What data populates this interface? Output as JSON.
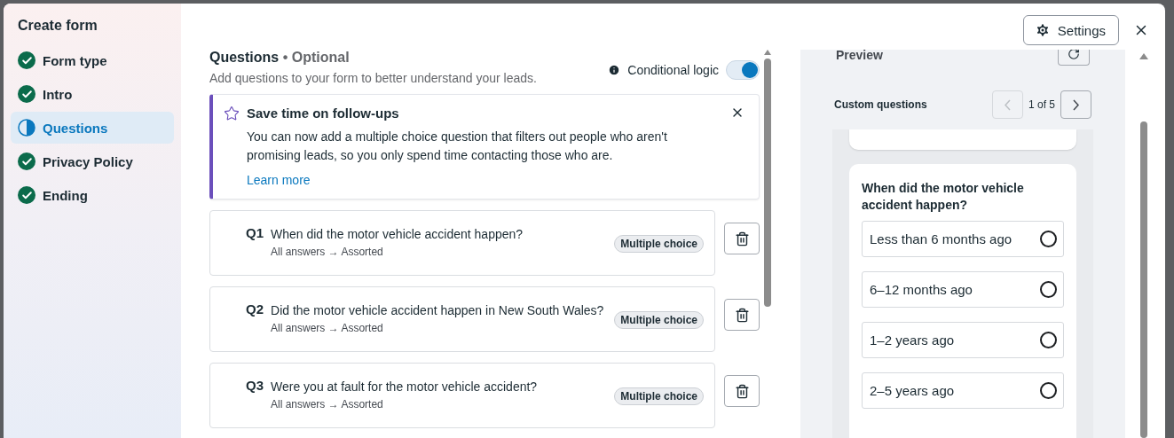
{
  "sidebar": {
    "title": "Create form",
    "steps": [
      {
        "label": "Form type",
        "complete": true,
        "selected": false
      },
      {
        "label": "Intro",
        "complete": true,
        "selected": false
      },
      {
        "label": "Questions",
        "complete": false,
        "selected": true
      },
      {
        "label": "Privacy Policy",
        "complete": true,
        "selected": false
      },
      {
        "label": "Ending",
        "complete": true,
        "selected": false
      }
    ]
  },
  "header": {
    "settings_button": "Settings"
  },
  "questions_section": {
    "title": "Questions",
    "optional": " • Optional",
    "subtitle": "Add questions to your form to better understand your leads.",
    "conditional_logic": {
      "label": "Conditional logic",
      "on": true
    },
    "banner": {
      "title": "Save time on follow-ups",
      "body": "You can now add a multiple choice question that filters out people who aren't promising leads, so you only spend time contacting those who are.",
      "link": "Learn more"
    },
    "questions": [
      {
        "number": "Q1",
        "text": "When did the motor vehicle accident happen?",
        "routing": "All answers → Assorted",
        "type": "Multiple choice"
      },
      {
        "number": "Q2",
        "text": "Did the motor vehicle accident happen in New South Wales?",
        "routing": "All answers → Assorted",
        "type": "Multiple choice"
      },
      {
        "number": "Q3",
        "text": "Were you at fault for the motor vehicle accident?",
        "routing": "All answers → Assorted",
        "type": "Multiple choice"
      }
    ]
  },
  "preview": {
    "title": "Preview",
    "section": "Custom questions",
    "pager": {
      "label": "1 of 5",
      "prev_disabled": true,
      "next_disabled": false
    },
    "question": "When did the motor vehicle accident happen?",
    "options": [
      {
        "label": "Less than 6 months ago",
        "selected": false
      },
      {
        "label": "6–12 months ago",
        "selected": false
      },
      {
        "label": "1–2 years ago",
        "selected": false
      },
      {
        "label": "2–5 years ago",
        "selected": false
      }
    ]
  }
}
